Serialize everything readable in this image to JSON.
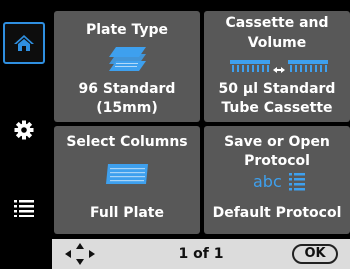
{
  "sidebar": {
    "items": [
      {
        "icon": "home-icon",
        "active": true
      },
      {
        "icon": "gear-icon",
        "active": false
      },
      {
        "icon": "list-icon",
        "active": false
      }
    ]
  },
  "tiles": {
    "plate_type": {
      "title": "Plate Type",
      "value_line1": "96 Standard",
      "value_line2": "(15mm)",
      "icon": "plate-stack-icon"
    },
    "cassette": {
      "title_line1": "Cassette and",
      "title_line2": "Volume",
      "value_line1": "50 µl Standard",
      "value_line2": "Tube Cassette",
      "icon": "cassette-volume-icon"
    },
    "columns": {
      "title": "Select Columns",
      "value": "Full Plate",
      "icon": "plate-columns-icon"
    },
    "protocol": {
      "title_line1": "Save or Open",
      "title_line2": "Protocol",
      "value": "Default Protocol",
      "icon_text": "abc",
      "icon": "text-list-icon"
    }
  },
  "footer": {
    "page_indicator": "1 of 1",
    "ok_label": "OK",
    "nav_icon": "four-way-arrows-icon"
  },
  "colors": {
    "tile_bg": "#585858",
    "accent": "#2f8fe0",
    "footer_bg": "#dcdcdc"
  }
}
